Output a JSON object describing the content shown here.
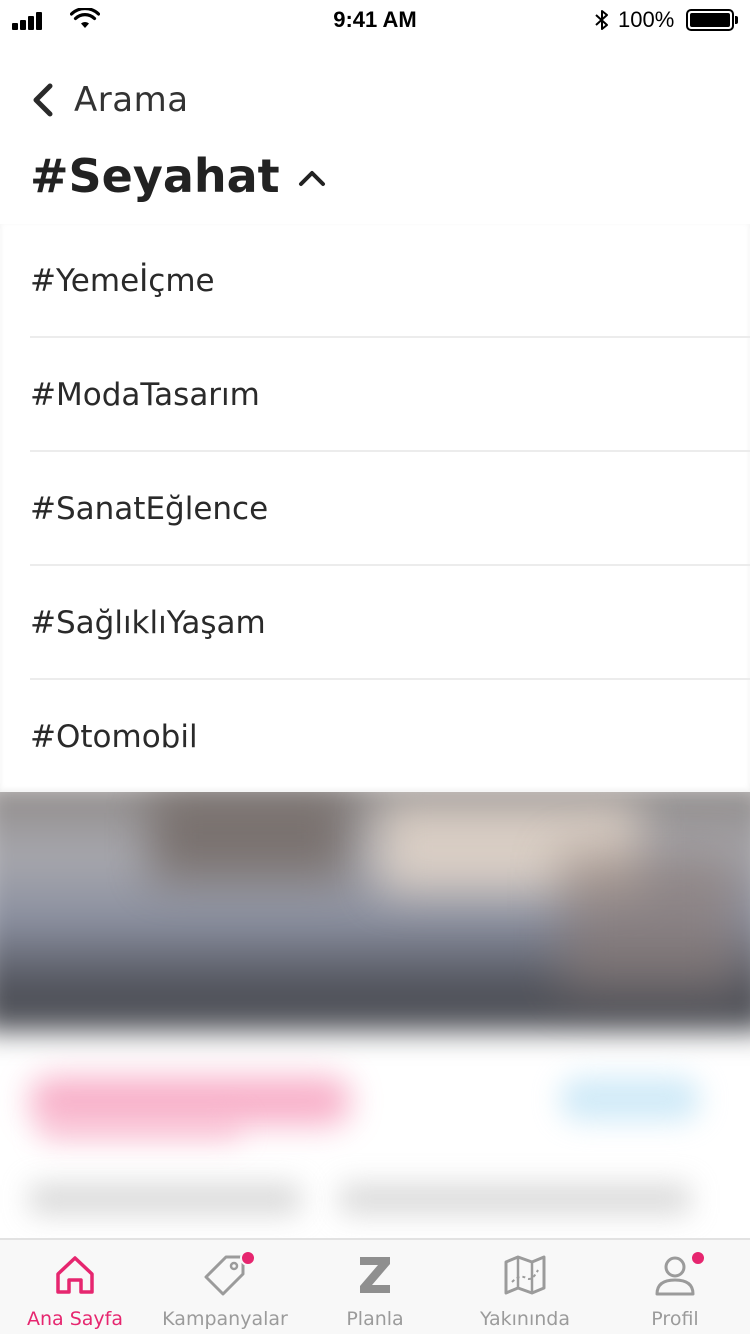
{
  "status_bar": {
    "time": "9:41 AM",
    "battery_percent": "100%",
    "icons": [
      "signal-icon",
      "wifi-icon",
      "bluetooth-icon",
      "battery-icon"
    ]
  },
  "header": {
    "back_label": "Arama",
    "title": "#Seyahat"
  },
  "dropdown": {
    "items": [
      {
        "label": "#Yemeİçme"
      },
      {
        "label": "#ModaTasarım"
      },
      {
        "label": "#SanatEğlence"
      },
      {
        "label": "#SağlıklıYaşam"
      },
      {
        "label": "#Otomobil"
      }
    ]
  },
  "tabbar": {
    "tabs": [
      {
        "label": "Ana Sayfa",
        "icon": "home-icon",
        "active": true
      },
      {
        "label": "Kampanyalar",
        "icon": "tag-icon",
        "badge": true
      },
      {
        "label": "Planla",
        "icon": "z-logo-icon"
      },
      {
        "label": "Yakınında",
        "icon": "map-icon"
      },
      {
        "label": "Profil",
        "icon": "profile-icon",
        "badge": true
      }
    ]
  },
  "colors": {
    "accent": "#e6266f",
    "inactive": "#9b9b9b",
    "text": "#2a2a2a"
  }
}
